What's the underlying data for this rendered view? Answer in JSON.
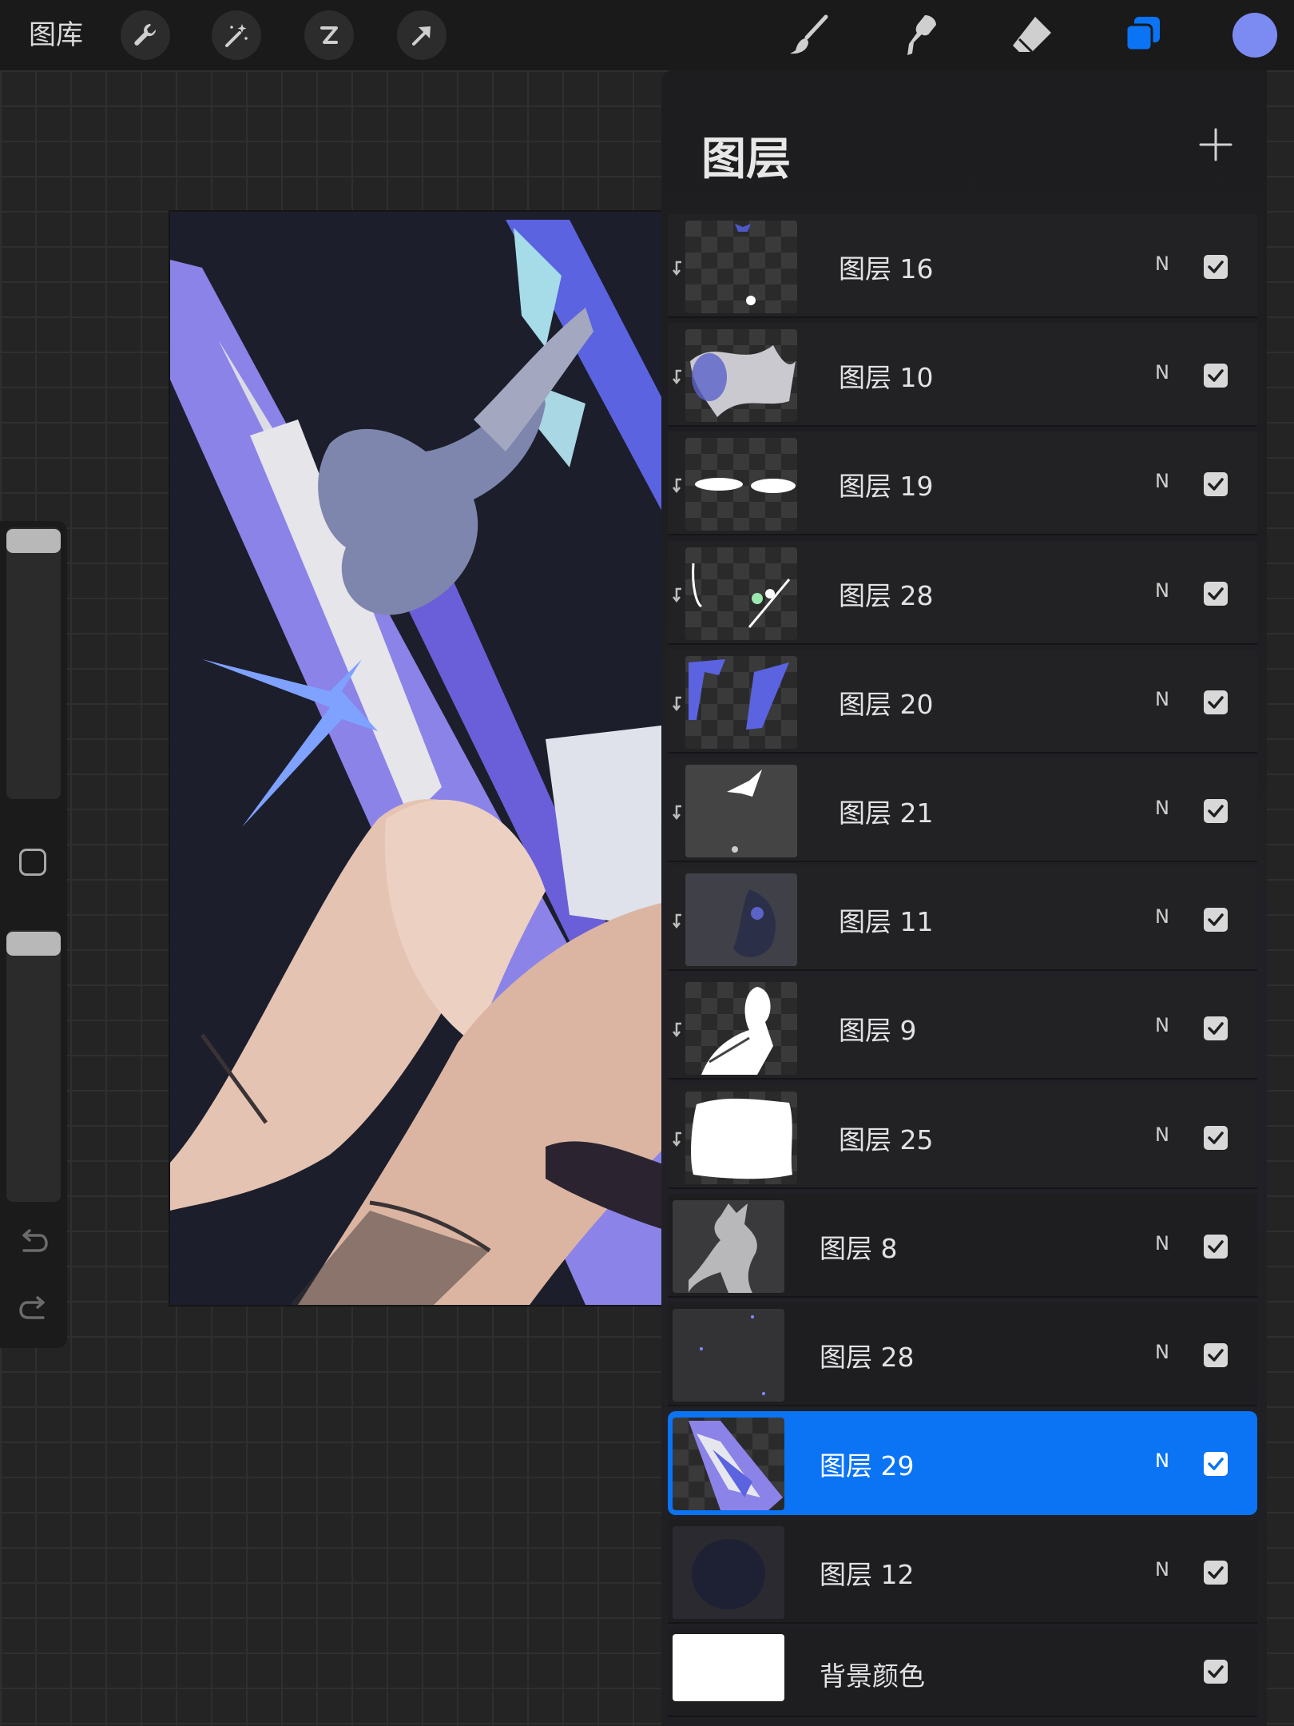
{
  "toolbar": {
    "gallery_label": "图库",
    "left_tools": [
      "wrench-icon",
      "magic-wand-icon",
      "selection-icon",
      "transform-arrow-icon"
    ],
    "right_tools": [
      "brush-icon",
      "smudge-icon",
      "eraser-icon",
      "layers-icon"
    ],
    "current_color": "#7c8bf2"
  },
  "layers_panel": {
    "title": "图层",
    "add_icon": "plus-icon",
    "selected_color": "#0a74f5",
    "layers": [
      {
        "name": "图层 16",
        "blend": "N",
        "visible": true,
        "clipped": true
      },
      {
        "name": "图层 10",
        "blend": "N",
        "visible": true,
        "clipped": true
      },
      {
        "name": "图层 19",
        "blend": "N",
        "visible": true,
        "clipped": true
      },
      {
        "name": "图层 28",
        "blend": "N",
        "visible": true,
        "clipped": true
      },
      {
        "name": "图层 20",
        "blend": "N",
        "visible": true,
        "clipped": true
      },
      {
        "name": "图层 21",
        "blend": "N",
        "visible": true,
        "clipped": true
      },
      {
        "name": "图层 11",
        "blend": "N",
        "visible": true,
        "clipped": true
      },
      {
        "name": "图层 9",
        "blend": "N",
        "visible": true,
        "clipped": true
      },
      {
        "name": "图层 25",
        "blend": "N",
        "visible": true,
        "clipped": true
      },
      {
        "name": "图层 8",
        "blend": "N",
        "visible": true,
        "clipped": false
      },
      {
        "name": "图层 28",
        "blend": "N",
        "visible": true,
        "clipped": false
      },
      {
        "name": "图层 29",
        "blend": "N",
        "visible": true,
        "clipped": false,
        "selected": true
      },
      {
        "name": "图层 12",
        "blend": "N",
        "visible": true,
        "clipped": false
      },
      {
        "name": "背景颜色",
        "blend": "",
        "visible": true,
        "clipped": false,
        "background": true
      }
    ]
  },
  "sidebar": {
    "undo_icon": "undo-icon",
    "redo_icon": "redo-icon",
    "modify_icon": "square-modify-icon"
  }
}
